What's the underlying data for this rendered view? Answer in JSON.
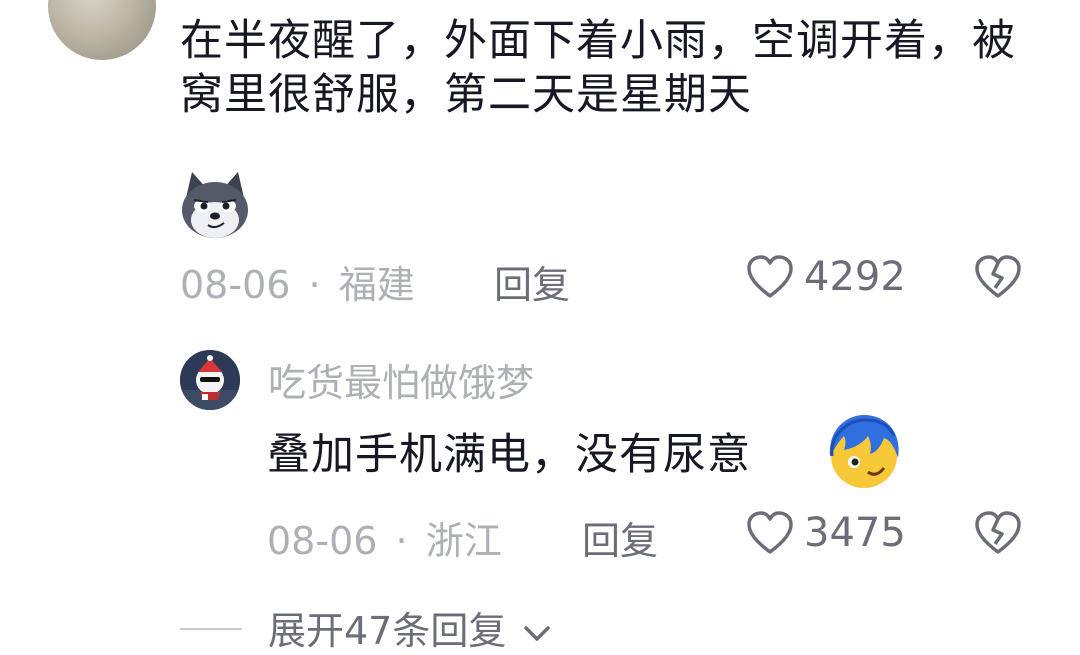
{
  "comment": {
    "text": "在半夜醒了，外面下着小雨，空调开着，被窝里很舒服，第二天是星期天",
    "emoji": "doge-emoji",
    "date": "08-06",
    "dot": "·",
    "location": "福建",
    "reply_label": "回复",
    "likes": "4292"
  },
  "reply": {
    "username": "吃货最怕做饿梦",
    "text": "叠加手机满电，没有尿意",
    "emoji": "face-emoji",
    "date": "08-06",
    "dot": "·",
    "location": "浙江",
    "reply_label": "回复",
    "likes": "3475"
  },
  "expand": {
    "label": "展开47条回复"
  },
  "icons": {
    "like": "heart-icon",
    "dislike": "broken-heart-icon",
    "expand": "chevron-down-icon"
  },
  "colors": {
    "text": "#161823",
    "meta": "#aeb0b7",
    "secondary": "#6b6e79"
  }
}
